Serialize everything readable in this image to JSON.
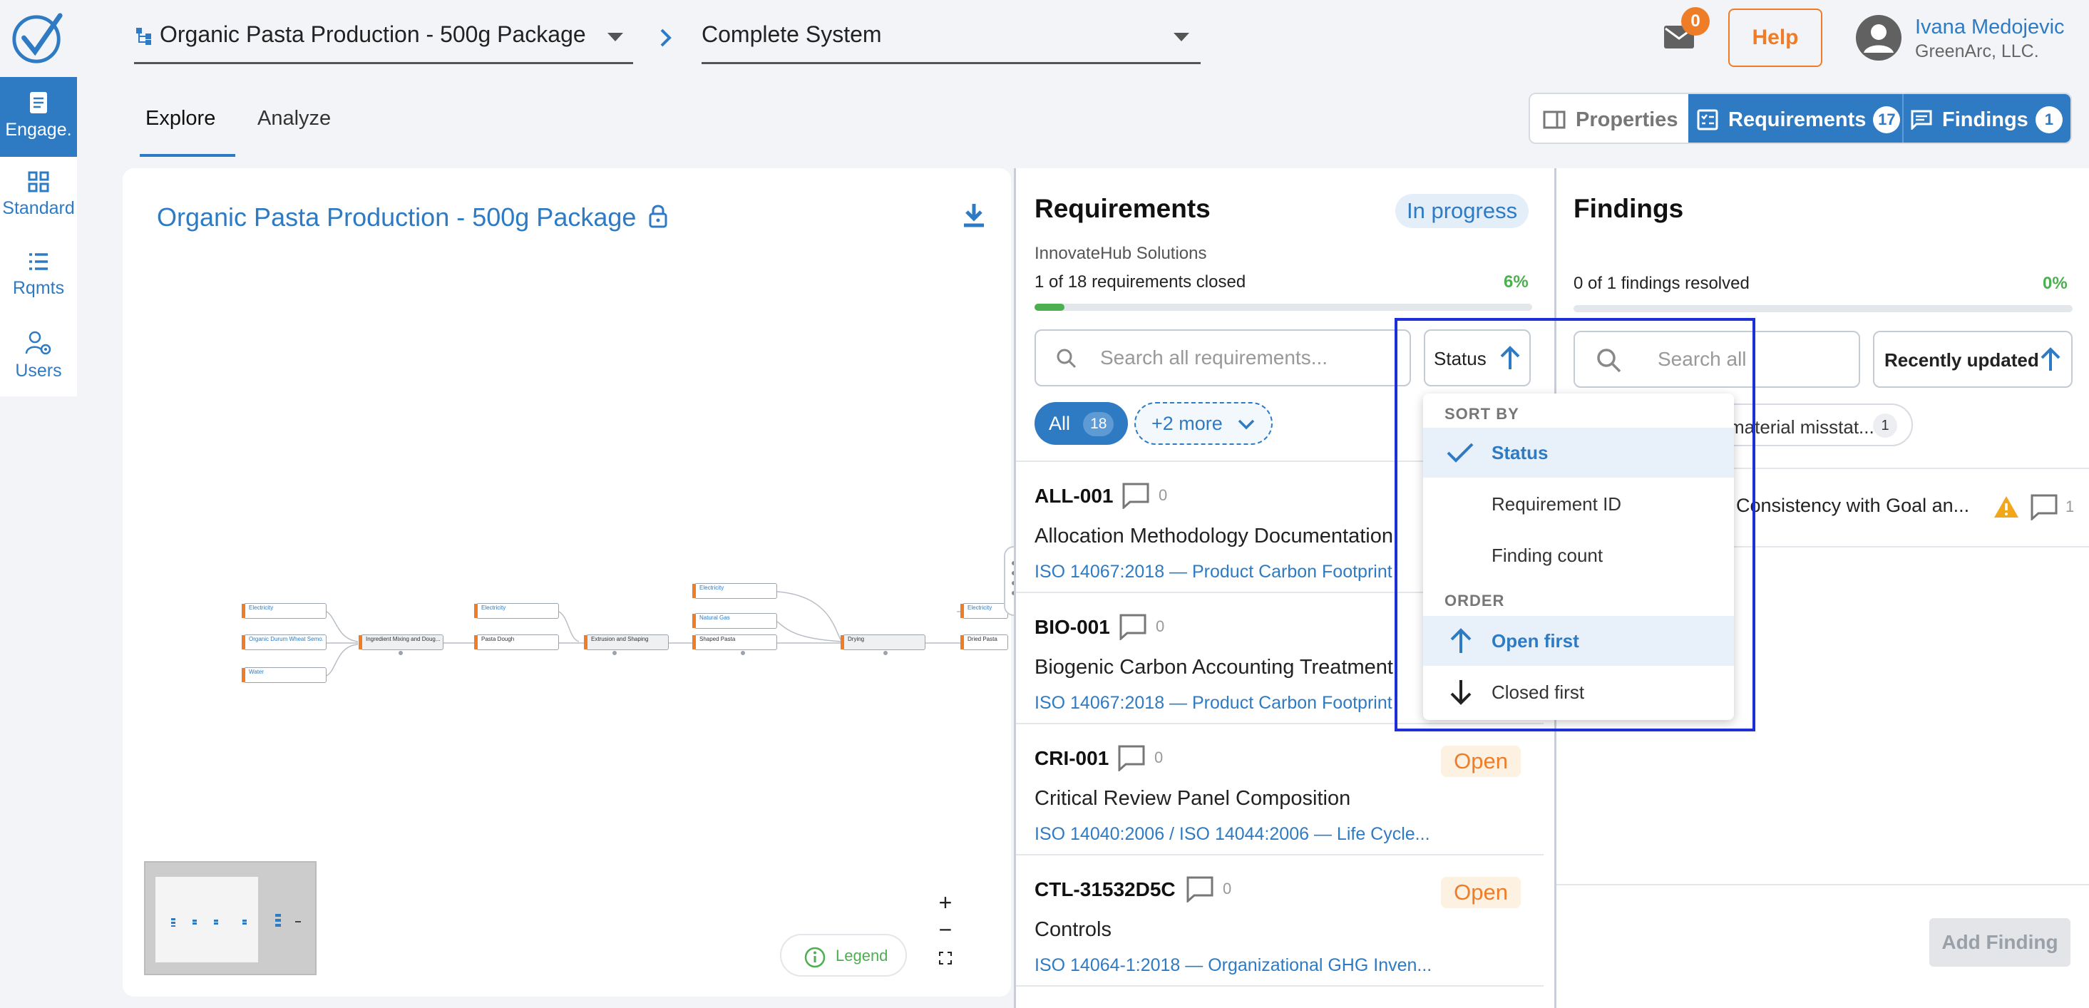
{
  "header": {
    "product_selector": "Organic Pasta Production - 500g Package",
    "scope_selector": "Complete System",
    "mail_count": "0",
    "help_label": "Help",
    "user_name": "Ivana Medojevic",
    "user_org": "GreenArc, LLC."
  },
  "sidebar": {
    "items": [
      {
        "label": "Engage.",
        "icon": "document-icon"
      },
      {
        "label": "Standard",
        "icon": "grid-icon"
      },
      {
        "label": "Rqmts",
        "icon": "list-icon"
      },
      {
        "label": "Users",
        "icon": "users-gear-icon"
      }
    ]
  },
  "tabs": [
    {
      "label": "Explore"
    },
    {
      "label": "Analyze"
    }
  ],
  "panel_toggle": {
    "properties_label": "Properties",
    "requirements_label": "Requirements",
    "requirements_count": "17",
    "findings_label": "Findings",
    "findings_count": "1"
  },
  "explore": {
    "title": "Organic Pasta Production - 500g Package",
    "legend_label": "Legend",
    "nodes": [
      {
        "label": "Electricity"
      },
      {
        "label": "Organic Durum Wheat Semo..."
      },
      {
        "label": "Water"
      },
      {
        "label": "Ingredient Mixing and Doug..."
      },
      {
        "label": "Electricity"
      },
      {
        "label": "Pasta Dough"
      },
      {
        "label": "Extrusion and Shaping"
      },
      {
        "label": "Electricity"
      },
      {
        "label": "Natural Gas"
      },
      {
        "label": "Shaped Pasta"
      },
      {
        "label": "Drying"
      },
      {
        "label": "Electricity"
      },
      {
        "label": "Dried Pasta"
      }
    ]
  },
  "requirements": {
    "title": "Requirements",
    "status": "In progress",
    "org": "InnovateHub Solutions",
    "progress_text": "1 of 18 requirements closed",
    "progress_pct": "6%",
    "progress_value": 0.06,
    "search_placeholder": "Search all requirements...",
    "sort_label": "Status",
    "filter_all_label": "All",
    "filter_all_count": "18",
    "filter_more_label": "+2 more",
    "items": [
      {
        "id": "ALL-001",
        "comments": "0",
        "title": "Allocation Methodology Documentation",
        "standard": "ISO 14067:2018 — Product Carbon Footprint",
        "status": ""
      },
      {
        "id": "BIO-001",
        "comments": "0",
        "title": "Biogenic Carbon Accounting Treatment",
        "standard": "ISO 14067:2018 — Product Carbon Footprint",
        "status": ""
      },
      {
        "id": "CRI-001",
        "comments": "0",
        "title": "Critical Review Panel Composition",
        "standard": "ISO 14040:2006 / ISO 14044:2006 — Life Cycle...",
        "status": "Open"
      },
      {
        "id": "CTL-31532D5C",
        "comments": "0",
        "title": "Controls",
        "standard": "ISO 14064-1:2018 — Organizational GHG Inven...",
        "status": "Open"
      }
    ]
  },
  "sort_dropdown": {
    "sort_by_heading": "SORT BY",
    "options": [
      "Status",
      "Requirement ID",
      "Finding count"
    ],
    "order_heading": "ORDER",
    "order_options": [
      "Open first",
      "Closed first"
    ],
    "selected_sort": "Status",
    "selected_order": "Open first"
  },
  "findings": {
    "title": "Findings",
    "progress_text": "0 of 1 findings resolved",
    "progress_pct": "0%",
    "search_placeholder": "Search all",
    "sort_label": "Recently updated",
    "filter_chip_label": "material misstat...",
    "filter_chip_count": "1",
    "item_title": "Consistency with Goal an...",
    "item_comments": "1",
    "add_button": "Add Finding"
  }
}
